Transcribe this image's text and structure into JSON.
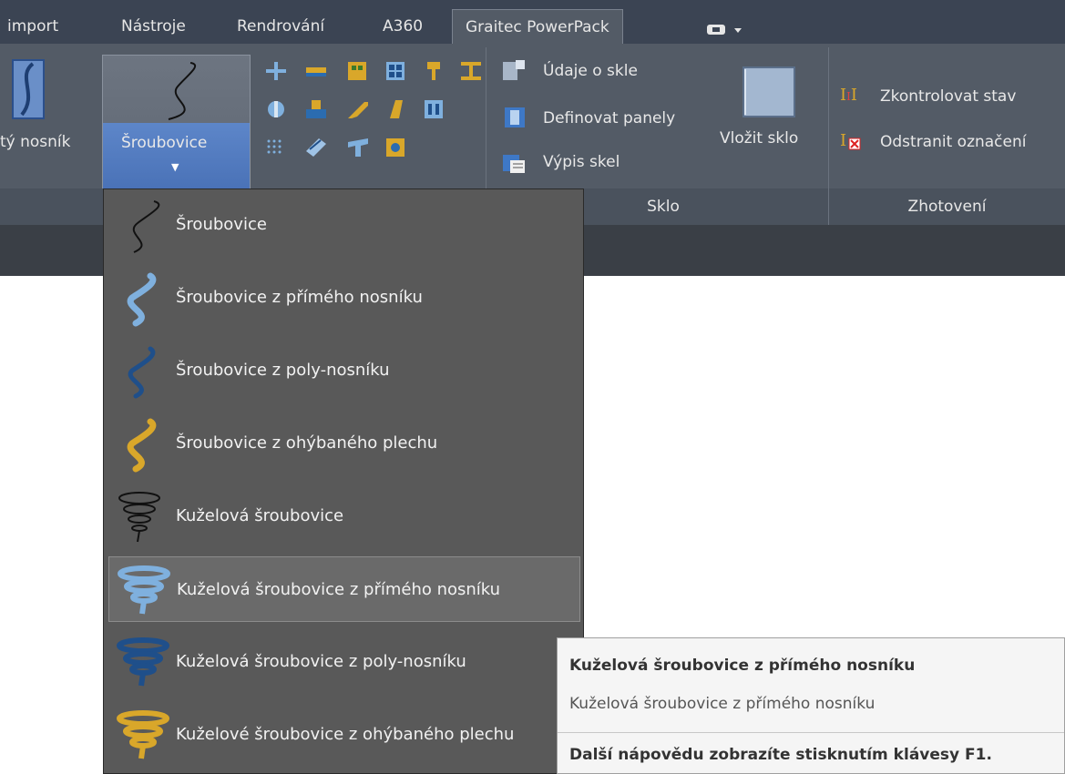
{
  "tabs": [
    "import",
    "Nástroje",
    "Rendrování",
    "A360",
    "Graitec PowerPack"
  ],
  "ribbon": {
    "partial_beam_label": "tý nosník",
    "helix_button_label": "Šroubovice",
    "glass": {
      "items": [
        "Údaje o skle",
        "Definovat panely",
        "Výpis skel"
      ],
      "insert_label": "Vložit sklo",
      "title": "Sklo"
    },
    "fabrication": {
      "items": [
        "Zkontrolovat stav",
        "Odstranit označení"
      ],
      "title": "Zhotovení"
    }
  },
  "menu": {
    "items": [
      {
        "label": "Šroubovice",
        "icon": "helix-black-icon"
      },
      {
        "label": "Šroubovice z přímého nosníku",
        "icon": "helix-light-blue-icon"
      },
      {
        "label": "Šroubovice z poly-nosníku",
        "icon": "helix-dark-blue-icon"
      },
      {
        "label": "Šroubovice z ohýbaného plechu",
        "icon": "helix-gold-icon"
      },
      {
        "label": "Kuželová šroubovice",
        "icon": "conical-helix-black-icon"
      },
      {
        "label": "Kuželová šroubovice z přímého nosníku",
        "icon": "conical-helix-light-blue-icon"
      },
      {
        "label": "Kuželová šroubovice z poly-nosníku",
        "icon": "conical-helix-dark-blue-icon"
      },
      {
        "label": "Kuželové šroubovice z ohýbaného plechu",
        "icon": "conical-helix-gold-icon"
      }
    ],
    "highlighted_index": 5
  },
  "tooltip": {
    "title": "Kuželová šroubovice z přímého nosníku",
    "description": "Kuželová šroubovice z přímého nosníku",
    "help": "Další nápovědu zobrazíte stisknutím klávesy F1."
  },
  "colors": {
    "ribbon": "#535b66",
    "highlight": "#4a72b7",
    "menu": "#595959",
    "helix_light_blue": "#7fb0de",
    "helix_dark_blue": "#1f4f8a",
    "helix_gold": "#d9a72a"
  }
}
